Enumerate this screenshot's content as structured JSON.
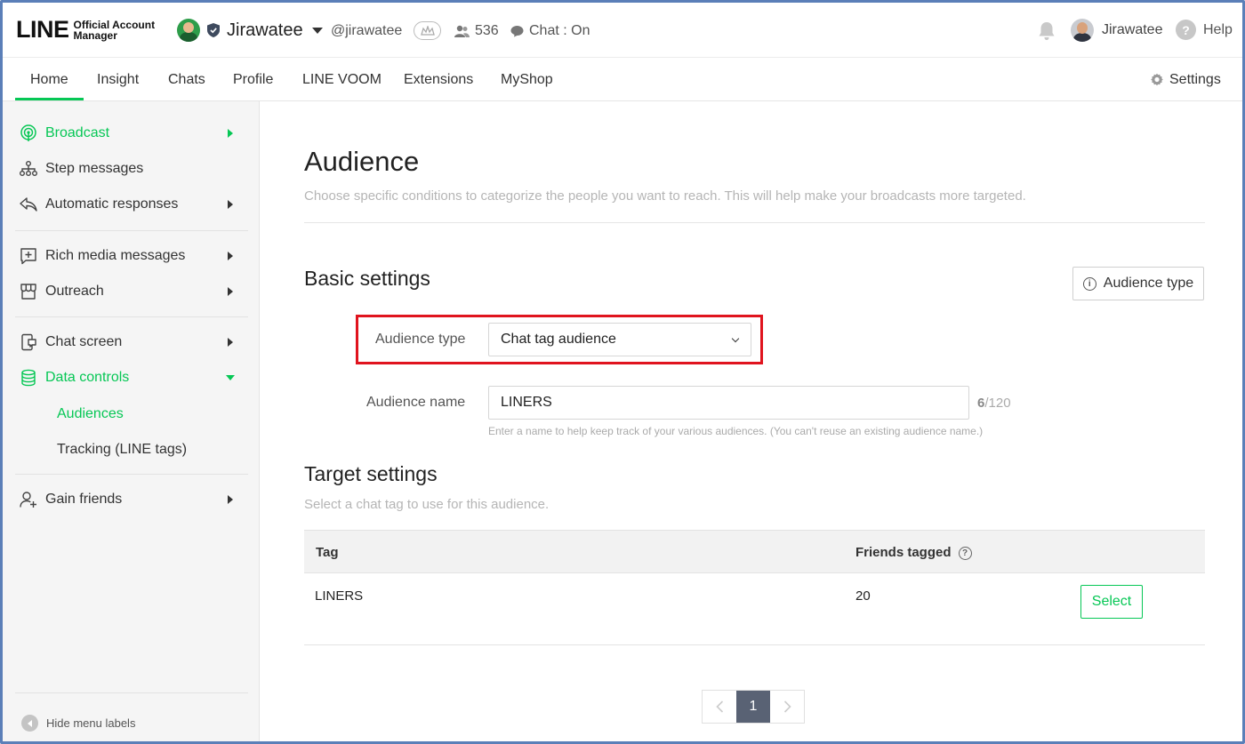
{
  "header": {
    "logo_main": "LINE",
    "logo_sub_1": "Official Account",
    "logo_sub_2": "Manager",
    "account_name": "Jirawatee",
    "account_handle": "@jirawatee",
    "friend_count": "536",
    "chat_status": "Chat : On",
    "user_name": "Jirawatee",
    "help_label": "Help"
  },
  "nav": {
    "tabs": [
      {
        "label": "Home"
      },
      {
        "label": "Insight"
      },
      {
        "label": "Chats"
      },
      {
        "label": "Profile"
      },
      {
        "label": "LINE VOOM"
      },
      {
        "label": "Extensions"
      },
      {
        "label": "MyShop"
      }
    ],
    "settings_label": "Settings"
  },
  "sidebar": {
    "items": [
      {
        "label": "Broadcast"
      },
      {
        "label": "Step messages"
      },
      {
        "label": "Automatic responses"
      },
      {
        "label": "Rich media messages"
      },
      {
        "label": "Outreach"
      },
      {
        "label": "Chat screen"
      },
      {
        "label": "Data controls"
      },
      {
        "label": "Gain friends"
      }
    ],
    "sub_items": [
      {
        "label": "Audiences"
      },
      {
        "label": "Tracking (LINE tags)"
      }
    ],
    "hide_labels": "Hide menu labels"
  },
  "main": {
    "title": "Audience",
    "description": "Choose specific conditions to categorize the people you want to reach. This will help make your broadcasts more targeted.",
    "basic_settings_title": "Basic settings",
    "audience_type_button": "Audience type",
    "audience_type_label": "Audience type",
    "audience_type_value": "Chat tag audience",
    "audience_name_label": "Audience name",
    "audience_name_value": "LINERS",
    "name_count": "6",
    "name_max": "/120",
    "name_hint": "Enter a name to help keep track of your various audiences. (You can't reuse an existing audience name.)",
    "target_settings_title": "Target settings",
    "target_desc": "Select a chat tag to use for this audience.",
    "table": {
      "headers": {
        "tag": "Tag",
        "friends_tagged": "Friends tagged"
      },
      "rows": [
        {
          "tag": "LINERS",
          "friends_tagged": "20",
          "action": "Select"
        }
      ]
    },
    "pagination": {
      "current": "1"
    }
  },
  "colors": {
    "brand_green": "#06c755",
    "highlight_red": "#e0141e",
    "pager_active": "#596274"
  }
}
